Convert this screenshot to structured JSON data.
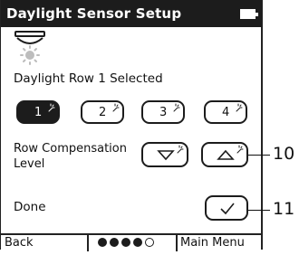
{
  "header": {
    "title": "Daylight Sensor Setup",
    "battery_icon": "battery-icon"
  },
  "sensor": {
    "icon": "daylight-sensor-icon"
  },
  "status": {
    "text": "Daylight Row 1 Selected"
  },
  "rows": [
    {
      "label": "1",
      "selected": true
    },
    {
      "label": "2",
      "selected": false
    },
    {
      "label": "3",
      "selected": false
    },
    {
      "label": "4",
      "selected": false
    }
  ],
  "compensation": {
    "label_line1": "Row Compensation",
    "label_line2": "Level",
    "down_icon": "triangle-down-icon",
    "up_icon": "triangle-up-icon"
  },
  "done": {
    "label": "Done",
    "icon": "checkmark-icon"
  },
  "footer": {
    "back_label": "Back",
    "main_menu_label": "Main Menu",
    "page_dots": {
      "filled": 4,
      "total": 5
    }
  },
  "callouts": {
    "up_button": "10",
    "done_button": "11"
  },
  "colors": {
    "foreground": "#1c1c1c",
    "background": "#ffffff"
  }
}
